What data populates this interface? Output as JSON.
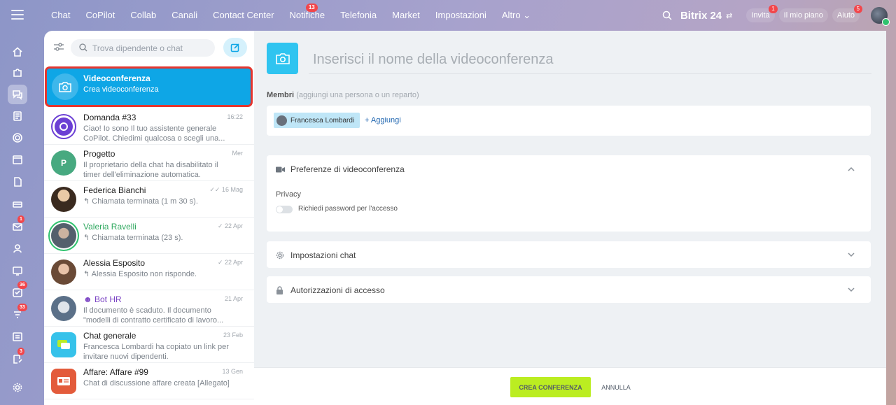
{
  "topnav": {
    "items": [
      {
        "label": "Chat"
      },
      {
        "label": "CoPilot"
      },
      {
        "label": "Collab"
      },
      {
        "label": "Canali"
      },
      {
        "label": "Contact Center"
      },
      {
        "label": "Notifiche",
        "badge": "13"
      },
      {
        "label": "Telefonia"
      },
      {
        "label": "Market"
      },
      {
        "label": "Impostazioni"
      },
      {
        "label": "Altro ⌄"
      }
    ]
  },
  "header": {
    "brand": "Bitrix 24",
    "invite_label": "Invita",
    "invite_badge": "1",
    "plan_label": "Il mio piano",
    "help_label": "Aiuto",
    "help_badge": "5"
  },
  "rail": {
    "badges": {
      "mail": "1",
      "tasks": "36",
      "feed": "33",
      "notes": "3"
    }
  },
  "chat": {
    "search_placeholder": "Trova dipendente o chat",
    "video_item": {
      "title": "Videoconferenza",
      "subtitle": "Crea videoconferenza"
    },
    "items": [
      {
        "title": "Domanda #33",
        "date": "16:22",
        "msg": "Ciao! Io sono Il tuo assistente generale CoPilot. Chiedimi qualcosa o scegli una..."
      },
      {
        "title": "Progetto",
        "date": "Mer",
        "msg": "Il proprietario della chat ha disabilitato il timer dell'eliminazione automatica.",
        "avatar_letter": "P"
      },
      {
        "title": "Federica Bianchi",
        "date": "✓✓ 16 Mag",
        "msg": "↰ Chiamata terminata (1 m 30 s)."
      },
      {
        "title": "Valeria Ravelli",
        "date": "✓ 22 Apr",
        "msg": "↰ Chiamata terminata (23 s)."
      },
      {
        "title": "Alessia Esposito",
        "date": "✓ 22 Apr",
        "msg": "↰ Alessia Esposito non risponde."
      },
      {
        "title": "Bot HR",
        "date": "21 Apr",
        "msg": "Il documento è scaduto. Il documento \"modelli di contratto certificato di lavoro..."
      },
      {
        "title": "Chat generale",
        "date": "23 Feb",
        "msg": "Francesca Lombardi ha copiato un link per invitare nuovi dipendenti."
      },
      {
        "title": "Affare: Affare #99",
        "date": "13 Gen",
        "msg": "Chat di discussione affare creata [Allegato]"
      }
    ]
  },
  "conference": {
    "name_placeholder": "Inserisci il nome della videoconferenza",
    "members_label": "Membri",
    "members_hint": "(aggiungi una persona o un reparto)",
    "member_chip": "Francesca Lombardi",
    "add_label": "+ Aggiungi",
    "prefs_title": "Preferenze di videoconferenza",
    "privacy_label": "Privacy",
    "password_toggle_label": "Richiedi password per l'accesso",
    "chat_settings_title": "Impostazioni chat",
    "access_title": "Autorizzazioni di accesso",
    "create_label": "CREA CONFERENZA",
    "cancel_label": "ANNULLA"
  },
  "colors": {
    "accent": "#0ea6e6",
    "highlight": "#e5362f",
    "create_btn": "#bbed21",
    "badge": "#f2464b"
  }
}
